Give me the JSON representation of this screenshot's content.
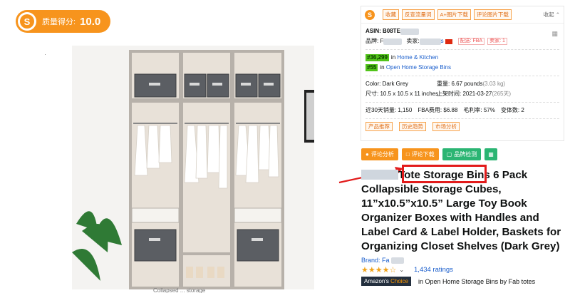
{
  "badge": {
    "label": "质量得分:",
    "score": "10.0"
  },
  "tiny_mark": "·",
  "caption": "Collapsed ... storage",
  "plugin": {
    "buttons": [
      "收藏",
      "反查流量词",
      "A+图片下载",
      "评论图片下载"
    ],
    "collapse": "收起 ⌃",
    "asin_label": "ASIN: B08TE",
    "brand_label": "品牌: F",
    "seller_label": "卖家:",
    "seller_suffix": "s",
    "delivery": "配送: FBA",
    "seller_count": "卖家: 1",
    "rank1": {
      "rank": "#36,299",
      "in": "in",
      "category": "Home & Kitchen"
    },
    "rank2": {
      "rank": "#55",
      "in": "in",
      "category": "Open Home Storage Bins"
    },
    "color": "Color: Dark Grey",
    "weight_label": "重量: 6.67 pounds",
    "weight_kg": "(3.03 kg)",
    "size": "尺寸: 10.5 x 10.5 x 11 inches",
    "launch_label": "上架时间: 2021-03-27",
    "launch_days": "(265天)",
    "sales30": "近30天销量: 1,150",
    "fba_fee": "FBA费用: $6.88",
    "margin": "毛利率: 57%",
    "variants": "变体数: 2",
    "bottom_buttons": [
      "产品推荐",
      "历史趋势",
      "市场分析"
    ]
  },
  "actions": [
    {
      "label": "评论分析",
      "color": "orange"
    },
    {
      "label": "评论下载",
      "color": "orange"
    },
    {
      "label": "品牌检测",
      "color": "green"
    }
  ],
  "product": {
    "title_lead": "Tote",
    "title_highlight": "Storage Bins",
    "title_rest": " 6 Pack Collapsible Storage Cubes, 11”x10.5”x10.5” Large Toy Book Organizer Boxes with Handles and Label Card & Label Holder, Baskets for Organizing Closet Shelves (Dark Grey)",
    "brand": "Brand: Fa",
    "stars": "★★★★☆",
    "ratings": "1,434 ratings",
    "choice_prefix": "Amazon's",
    "choice_suffix": "Choice",
    "choice_text": "in Open Home Storage Bins",
    "choice_by": "by Fab totes"
  },
  "colors": {
    "accent": "#f7941d",
    "highlight": "#e21b1b",
    "link": "#1a5ecc",
    "green": "#2bb573"
  },
  "icons": [
    "logo-icon",
    "flag-icon",
    "chat-icon",
    "download-icon",
    "check-icon",
    "calculator-icon",
    "red-arrow"
  ]
}
